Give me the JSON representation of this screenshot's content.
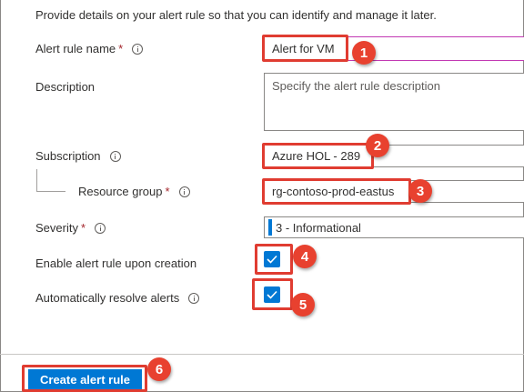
{
  "intro": "Provide details on your alert rule so that you can identify and manage it later.",
  "form": {
    "alert_rule_name": {
      "label": "Alert rule name",
      "required": "*",
      "value": "Alert for VM"
    },
    "description": {
      "label": "Description",
      "placeholder": "Specify the alert rule description"
    },
    "subscription": {
      "label": "Subscription",
      "value": "Azure HOL - 289"
    },
    "resource_group": {
      "label": "Resource group",
      "required": "*",
      "value": "rg-contoso-prod-eastus"
    },
    "severity": {
      "label": "Severity",
      "required": "*",
      "value": "3 - Informational",
      "color": "#0078d4"
    },
    "enable_on_creation": {
      "label": "Enable alert rule upon creation",
      "checked": true
    },
    "auto_resolve": {
      "label": "Automatically resolve alerts",
      "checked": true
    }
  },
  "footer": {
    "create_label": "Create alert rule"
  },
  "callouts": [
    "1",
    "2",
    "3",
    "4",
    "5",
    "6"
  ],
  "colors": {
    "accent": "#0078d4",
    "callout": "#e03c31",
    "required": "#a4262c"
  }
}
